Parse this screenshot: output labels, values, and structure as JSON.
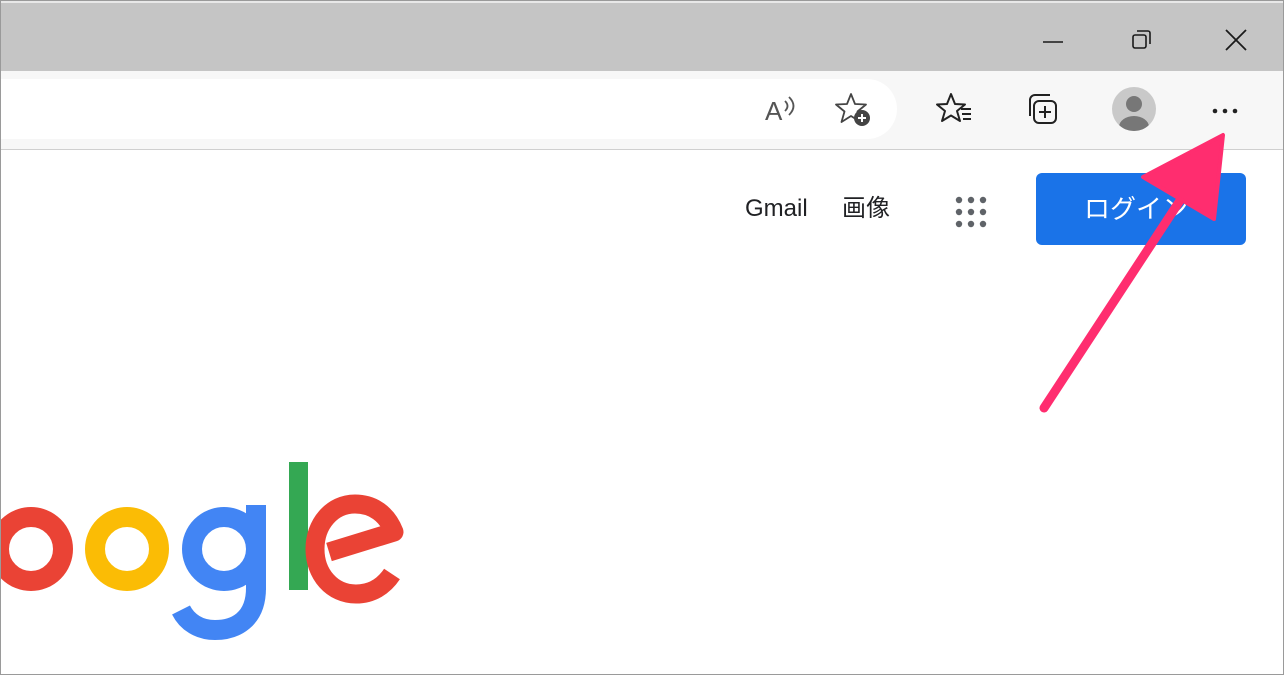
{
  "window": {
    "controls": [
      "minimize",
      "restore",
      "close"
    ]
  },
  "toolbar": {
    "icons": [
      "read-aloud-icon",
      "add-favorite-icon",
      "favorites-icon",
      "collections-icon",
      "profile-icon",
      "more-icon"
    ]
  },
  "google": {
    "links": {
      "gmail": "Gmail",
      "images": "画像"
    },
    "sign_in_label": "ログイン",
    "logo_text": "Google",
    "logo_colors": {
      "red": "#ea4335",
      "yellow": "#fbbc05",
      "blue": "#4285f4",
      "green": "#34a853"
    }
  },
  "annotation": {
    "color": "#ff2d6f"
  }
}
